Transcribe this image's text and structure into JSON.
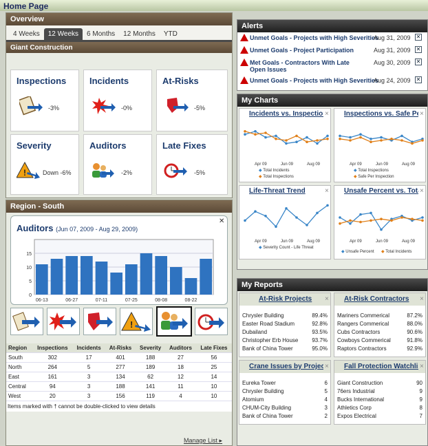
{
  "page_title": "Home Page",
  "overview": {
    "title": "Overview",
    "tabs": [
      "4 Weeks",
      "12 Weeks",
      "6 Months",
      "12 Months",
      "YTD"
    ],
    "active_tab": "12 Weeks",
    "company": "Giant Construction",
    "kpis": [
      {
        "title": "Inspections",
        "value": "-3%"
      },
      {
        "title": "Incidents",
        "value": "-0%"
      },
      {
        "title": "At-Risks",
        "value": "-5%"
      },
      {
        "title": "Severity",
        "value": "Down -6%"
      },
      {
        "title": "Auditors",
        "value": "-2%"
      },
      {
        "title": "Late Fixes",
        "value": "-5%"
      }
    ]
  },
  "region": {
    "title": "Region - South",
    "chart_title": "Auditors",
    "chart_range": "(Jun 07, 2009 - Aug 29, 2009)",
    "table": {
      "headers": [
        "Region",
        "Inspections",
        "Incidents",
        "At-Risks",
        "Severity",
        "Auditors",
        "Late Fixes"
      ],
      "rows": [
        [
          "South",
          "302",
          "17",
          "401",
          "188",
          "27",
          "56"
        ],
        [
          "North",
          "264",
          "5",
          "277",
          "189",
          "18",
          "25"
        ],
        [
          "East",
          "161",
          "3",
          "134",
          "62",
          "12",
          "14"
        ],
        [
          "Central",
          "94",
          "3",
          "188",
          "141",
          "11",
          "10"
        ],
        [
          "West",
          "20",
          "3",
          "156",
          "119",
          "4",
          "10"
        ]
      ],
      "footnote": "Items marked with † cannot be double-clicked to view details",
      "manage": "Manage List ▸"
    }
  },
  "chart_data": [
    {
      "type": "bar",
      "title": "Auditors",
      "ylim": [
        0,
        20
      ],
      "yticks": [
        "0",
        "5",
        "10",
        "15"
      ],
      "xticks": [
        "06-13",
        "06-27",
        "07-11",
        "07-25",
        "08-08",
        "08-22"
      ],
      "values": [
        11,
        13,
        14,
        14,
        12,
        8,
        11,
        15,
        14,
        10,
        6,
        13
      ]
    }
  ],
  "alerts": {
    "title": "Alerts",
    "items": [
      {
        "text": "Unmet Goals - Projects with High Severities",
        "date": "Aug 31, 2009"
      },
      {
        "text": "Unmet Goals - Project Participation",
        "date": "Aug 31, 2009"
      },
      {
        "text": "Met Goals - Contractors With Late Open Issues",
        "date": "Aug 30, 2009"
      },
      {
        "text": "Unmet Goals - Projects with High Severities",
        "date": "Aug 24, 2009"
      }
    ]
  },
  "charts": {
    "title": "My Charts",
    "items": [
      {
        "title": "Incidents vs. Inspections",
        "xlab": [
          "Apr 09",
          "Jun 09",
          "Aug 09"
        ],
        "legend": [
          "Total Incidents",
          "Total Inspections"
        ]
      },
      {
        "title": "Inspections vs. Safe Per",
        "xlab": [
          "Apr 09",
          "Jun 09",
          "Aug 09"
        ],
        "legend": [
          "Total Inspections",
          "Safe Per Inspection"
        ]
      },
      {
        "title": "Life-Threat Trend",
        "xlab": [
          "Apr 09",
          "Jun 09",
          "Aug 09"
        ],
        "legend": [
          "Severity Count - Life Threat"
        ]
      },
      {
        "title": "Unsafe Percent vs. Total",
        "xlab": [
          "Apr 09",
          "Jun 09",
          "Aug 09"
        ],
        "legend": [
          "Unsafe Percent",
          "Total Incidents"
        ]
      }
    ]
  },
  "reports": {
    "title": "My Reports",
    "atrisk_projects": {
      "title": "At-Risk Projects",
      "rows": [
        [
          "Chrysler Building",
          "89.4%"
        ],
        [
          "Easter Road Stadium",
          "92.8%"
        ],
        [
          "Dubailand",
          "93.5%"
        ],
        [
          "Christopher Erb House",
          "93.7%"
        ],
        [
          "Bank of China Tower",
          "95.0%"
        ]
      ]
    },
    "atrisk_contractors": {
      "title": "At-Risk Contractors",
      "rows": [
        [
          "Mariners Commerical",
          "87.2%"
        ],
        [
          "Rangers Commerical",
          "88.0%"
        ],
        [
          "Cubs Contractors",
          "90.6%"
        ],
        [
          "Cowboys Commerical",
          "91.8%"
        ],
        [
          "Raptors Contractors",
          "92.9%"
        ]
      ]
    },
    "crane": {
      "title": "Crane Issues by Project",
      "rows": [
        [
          "Eureka Tower",
          "6"
        ],
        [
          "Chrysler Building",
          "5"
        ],
        [
          "Atomium",
          "4"
        ],
        [
          "CHUM-City Building",
          "3"
        ],
        [
          "Bank of China Tower",
          "2"
        ]
      ]
    },
    "fall": {
      "title": "Fall Protection Watchlist",
      "rows": [
        [
          "Giant Construction",
          "90"
        ],
        [
          "76ers Industrial",
          "9"
        ],
        [
          "Bucks International",
          "9"
        ],
        [
          "Athletics Corp",
          "8"
        ],
        [
          "Expos Electrical",
          "7"
        ]
      ]
    }
  }
}
